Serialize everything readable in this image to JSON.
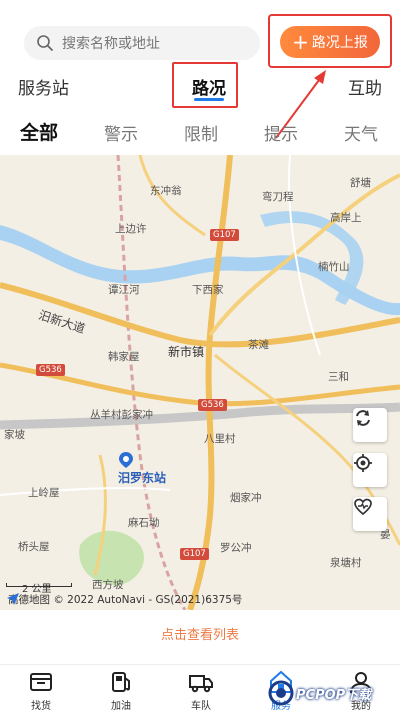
{
  "search": {
    "placeholder": "搜索名称或地址"
  },
  "report_button": {
    "label": "路况上报"
  },
  "main_tabs": [
    {
      "label": "服务站"
    },
    {
      "label": "路况",
      "active": true
    },
    {
      "label": "互助"
    }
  ],
  "sub_tabs": [
    {
      "label": "全部",
      "active": true
    },
    {
      "label": "警示"
    },
    {
      "label": "限制"
    },
    {
      "label": "提示"
    },
    {
      "label": "天气"
    }
  ],
  "map": {
    "places": {
      "dongchongweng": "东冲翁",
      "qiedaocheng": "弯刀程",
      "shutang": "舒塘",
      "shangbianxu": "上边许",
      "gaoanshang": "高岸上",
      "nanzhushan": "楠竹山",
      "tanjiahe": "谭江河",
      "xiaxijia": "下西家",
      "xinshizhen": "新市镇",
      "chatan": "茶滩",
      "hanjiawu": "韩家屋",
      "sanhe": "三和",
      "congyangcun": "丛羊村彭家冲",
      "balicun": "八里村",
      "luoluodongzhan": "汨罗东站",
      "shangling": "上岭屋",
      "yanjiachong": "烟家冲",
      "mashiyun": "麻石坳",
      "qiaotouwu": "桥头屋",
      "luogongchong": "罗公冲",
      "xifangpo": "西方坡",
      "jiantangcun": "泉塘村",
      "yanshang": "晏",
      "jiangzhenghu": "汨新大道",
      "left_edge": "家坡"
    },
    "roads": {
      "g107_top": "G107",
      "g107_bottom": "G107",
      "g536_left": "G536",
      "g536_mid": "G536"
    },
    "scale_label": "2 公里",
    "copyright": "高德地图 © 2022 AutoNavi - GS(2021)6375号"
  },
  "view_list": {
    "label": "点击查看列表"
  },
  "bottom_nav": [
    {
      "label": "找货",
      "icon": "cargo-icon"
    },
    {
      "label": "加油",
      "icon": "fuel-icon"
    },
    {
      "label": "车队",
      "icon": "truck-icon"
    },
    {
      "label": "服务",
      "icon": "home-service-icon",
      "active": true
    },
    {
      "label": "我的",
      "icon": "user-icon"
    }
  ],
  "watermark": {
    "text": "PCPOP下载"
  },
  "colors": {
    "accent": "#f2673a",
    "active_blue": "#1e7be8",
    "annotation_red": "#e53935"
  }
}
